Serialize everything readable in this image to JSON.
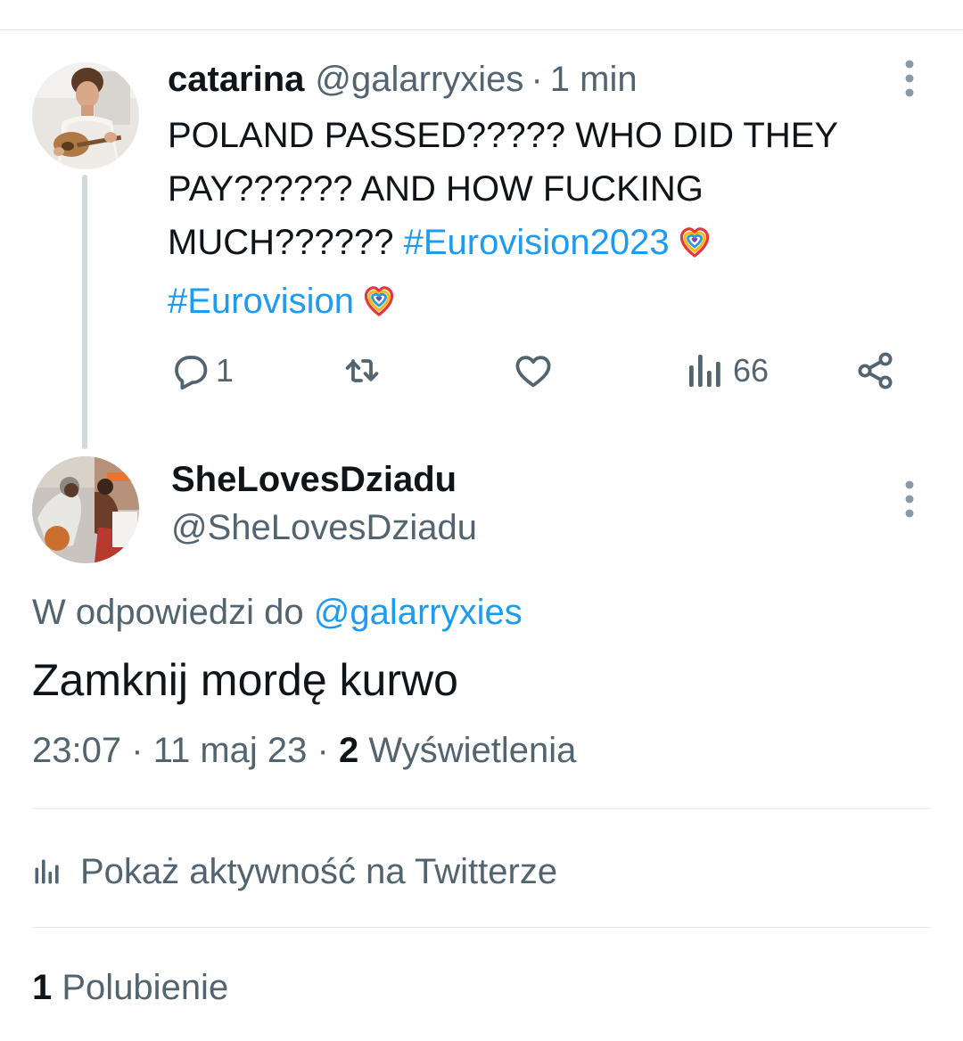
{
  "original_tweet": {
    "display_name": "catarina",
    "handle": "@galarryxies",
    "separator": "·",
    "time": "1 min",
    "text": "POLAND PASSED????? WHO DID THEY PAY?????? AND HOW FUCKING MUCH??????",
    "hashtags": [
      "#Eurovision2023",
      "#Eurovision"
    ],
    "hashtag_emoji_icon": "eurovision-heart-logo-icon",
    "actions": {
      "reply_count": "1",
      "retweet_count": "",
      "like_count": "",
      "views_count": "66"
    }
  },
  "reply_tweet": {
    "display_name": "SheLovesDziadu",
    "handle": "@SheLovesDziadu",
    "reply_prefix": "W odpowiedzi do",
    "reply_mention": "@galarryxies",
    "text": "Zamknij mordę kurwo",
    "time": "23:07",
    "date": "11 maj 23",
    "separator": "·",
    "views_count": "2",
    "views_label": "Wyświetlenia"
  },
  "activity_link": "Pokaż aktywność na Twitterze",
  "likes": {
    "count": "1",
    "label": "Polubienie"
  },
  "colors": {
    "text_primary": "#0f1419",
    "text_secondary": "#536471",
    "link": "#1d9bf0",
    "divider": "#e6e9ec",
    "thread_line": "#cfd9de"
  }
}
